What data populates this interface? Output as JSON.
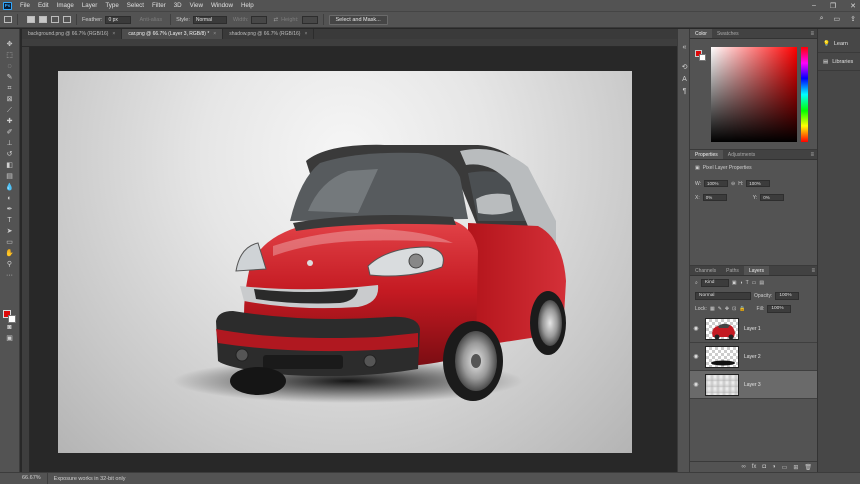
{
  "app": {
    "logo": "Ps"
  },
  "menu": [
    "File",
    "Edit",
    "Image",
    "Layer",
    "Type",
    "Select",
    "Filter",
    "3D",
    "View",
    "Window",
    "Help"
  ],
  "options": {
    "feather_label": "Feather:",
    "feather_value": "0 px",
    "antialias_label": "Anti-alias",
    "style_label": "Style:",
    "style_value": "Normal",
    "width_label": "Width:",
    "height_label": "Height:",
    "select_mask_label": "Select and Mask..."
  },
  "tabs": [
    {
      "label": "background.png @ 66.7% (RGB/16)"
    },
    {
      "label": "car.png @ 66.7% (Layer 3, RGB/8) *"
    },
    {
      "label": "shadow.png @ 66.7% (RGB/16)"
    }
  ],
  "status": {
    "zoom": "66.67%",
    "message": "Exposure works in 32-bit only"
  },
  "color_panel": {
    "tabs": [
      "Color",
      "Swatches"
    ],
    "foreground": "#e00808",
    "background": "#ffffff"
  },
  "properties_panel": {
    "tabs": [
      "Properties",
      "Adjustments"
    ],
    "heading": "Pixel Layer Properties",
    "w_label": "W:",
    "w_value": "100%",
    "h_label": "H:",
    "h_value": "100%",
    "x_label": "X:",
    "x_value": "0%",
    "y_label": "Y:",
    "y_value": "0%"
  },
  "layers_panel": {
    "tabs": [
      "Channels",
      "Paths",
      "Layers"
    ],
    "kind_label": "Kind",
    "blend_mode": "Normal",
    "opacity_label": "Opacity:",
    "opacity_value": "100%",
    "lock_label": "Lock:",
    "fill_label": "Fill:",
    "fill_value": "100%",
    "layers": [
      {
        "name": "Layer 1",
        "thumb": "car"
      },
      {
        "name": "Layer 2",
        "thumb": "shadow"
      },
      {
        "name": "Layer 3",
        "thumb": "gradient",
        "selected": true
      }
    ]
  },
  "learn_strip": [
    {
      "label": "Learn",
      "icon": "lightbulb-icon"
    },
    {
      "label": "Libraries",
      "icon": "libraries-icon"
    }
  ]
}
